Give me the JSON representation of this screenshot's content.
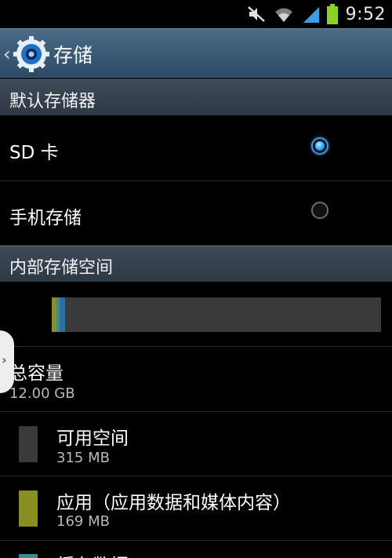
{
  "status_bar": {
    "time": "9:52",
    "icons": [
      "mute-icon",
      "wifi-icon",
      "signal-icon",
      "battery-icon"
    ],
    "battery_color": "#8cd21e"
  },
  "action_bar": {
    "back_icon": "chevron-left-icon",
    "app_icon": "settings-gear-icon",
    "title": "存储"
  },
  "default_storage": {
    "header": "默认存储器",
    "options": [
      {
        "label": "SD 卡",
        "selected": true
      },
      {
        "label": "手机存储",
        "selected": false
      }
    ]
  },
  "internal_storage": {
    "header": "内部存储空间",
    "usage_bar": {
      "segments": [
        {
          "name": "apps",
          "color": "#8a8f21",
          "fraction": 0.0141
        },
        {
          "name": "cache",
          "color": "#3a8a98",
          "fraction": 0.0035
        },
        {
          "name": "other",
          "color": "#2f6f9a",
          "fraction": 0.01
        },
        {
          "name": "free",
          "color": "#3a3a3a",
          "fraction": 0.9724
        }
      ]
    },
    "total": {
      "label": "总容量",
      "value": "12.00 GB"
    },
    "items": [
      {
        "label": "可用空间",
        "value": "315 MB",
        "color": "#3a3a3a"
      },
      {
        "label": "应用（应用数据和媒体内容）",
        "value": "169 MB",
        "color": "#8a8f21"
      },
      {
        "label": "缓存数据",
        "value": "",
        "color": "#3a8a98"
      }
    ]
  },
  "side_tab_icon": "chevron-right-icon"
}
